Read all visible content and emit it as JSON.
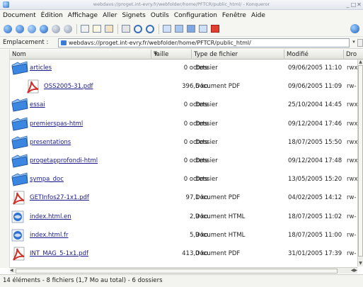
{
  "window": {
    "title": "webdavs://proget.int-evry.fr/webfolder/home/PFTCR/public_html/ - Konqueror"
  },
  "menubar": {
    "items": [
      "Document",
      "Édition",
      "Affichage",
      "Aller",
      "Signets",
      "Outils",
      "Configuration",
      "Fenêtre",
      "Aide"
    ]
  },
  "locationbar": {
    "label": "Emplacement :",
    "value": "webdavs://proget.int-evry.fr/webfolder/home/PFTCR/public_html/"
  },
  "columns": {
    "name": "Nom",
    "size": "Taille",
    "type": "Type de fichier",
    "modified": "Modifié",
    "perm": "Dro"
  },
  "files": [
    {
      "name": "articles",
      "size": "0 octets",
      "type": "Dossier",
      "modified": "09/06/2005 11:10",
      "perm": "rwx",
      "kind": "folder",
      "indent": 0
    },
    {
      "name": "OSS2005-31.pdf",
      "size": "396,6 ko",
      "type": "Document PDF",
      "modified": "09/06/2005 11:09",
      "perm": "rw-",
      "kind": "pdf",
      "indent": 1
    },
    {
      "name": "essai",
      "size": "0 octets",
      "type": "Dossier",
      "modified": "25/10/2004 14:45",
      "perm": "rwx",
      "kind": "folder",
      "indent": 0
    },
    {
      "name": "premierspas-html",
      "size": "0 octets",
      "type": "Dossier",
      "modified": "09/12/2004 17:46",
      "perm": "rwx",
      "kind": "folder",
      "indent": 0
    },
    {
      "name": "presentations",
      "size": "0 octets",
      "type": "Dossier",
      "modified": "18/07/2005 15:50",
      "perm": "rwx",
      "kind": "folder",
      "indent": 0
    },
    {
      "name": "progetapprofondi-html",
      "size": "0 octets",
      "type": "Dossier",
      "modified": "09/12/2004 17:48",
      "perm": "rwx",
      "kind": "folder",
      "indent": 0
    },
    {
      "name": "sympa_doc",
      "size": "0 octets",
      "type": "Dossier",
      "modified": "13/05/2005 15:20",
      "perm": "rwx",
      "kind": "folder",
      "indent": 0
    },
    {
      "name": "GETInfos27-1x1.pdf",
      "size": "97,1 ko",
      "type": "Document PDF",
      "modified": "04/02/2005 14:12",
      "perm": "rw-",
      "kind": "pdf",
      "indent": 0
    },
    {
      "name": "index.html.en",
      "size": "2,9 ko",
      "type": "Document HTML",
      "modified": "18/07/2005 11:02",
      "perm": "rw-",
      "kind": "html",
      "indent": 0
    },
    {
      "name": "index.html.fr",
      "size": "5,9 ko",
      "type": "Document HTML",
      "modified": "18/07/2005 11:00",
      "perm": "rw-",
      "kind": "html",
      "indent": 0
    },
    {
      "name": "INT_MAG_5-1x1.pdf",
      "size": "413,0 ko",
      "type": "Document PDF",
      "modified": "31/01/2005 17:39",
      "perm": "rw-",
      "kind": "pdf",
      "indent": 0
    }
  ],
  "status": {
    "text": "14 éléments - 8 fichiers (1,7 Mo au total) - 6 dossiers"
  },
  "colors": {
    "folder": "#3a86e0",
    "pdf": "#d0302a",
    "link": "#1a1a8c"
  },
  "icons": {
    "folder": "folder-icon",
    "pdf": "pdf-file-icon",
    "html": "html-file-icon"
  }
}
